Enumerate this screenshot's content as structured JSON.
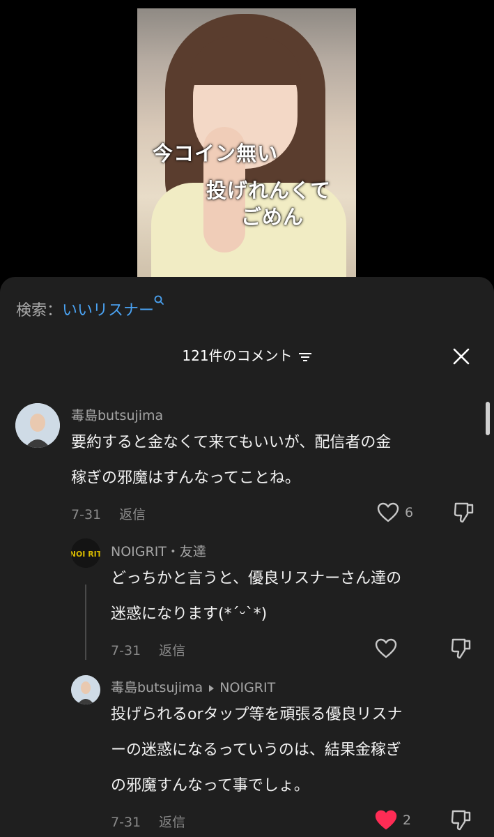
{
  "video": {
    "caption_line1": "今コイン無い",
    "caption_line2": "投げれんくて",
    "caption_line3": "ごめん"
  },
  "search": {
    "label": "検索：",
    "query": "いいリスナー"
  },
  "header": {
    "title": "121件のコメント"
  },
  "comments": [
    {
      "user": "毒島butsujima",
      "line1": "要約すると金なくて来てもいいが、配信者の金",
      "line2": "稼ぎの邪魔はすんなってことね。",
      "date": "7-31",
      "reply_label": "返信",
      "likes": "6",
      "liked": false
    },
    {
      "user": "NOIGRIT",
      "tag": "・友達",
      "line1": "どっちかと言うと、優良リスナーさん達の",
      "line2": "迷惑になります(*ˊᵕˋ*)",
      "date": "7-31",
      "reply_label": "返信",
      "likes": "",
      "liked": false
    },
    {
      "user": "毒島butsujima",
      "reply_to": "NOIGRIT",
      "line1": "投げられるorタップ等を頑張る優良リスナ",
      "line2": "ーの迷惑になるっていうのは、結果金稼ぎ",
      "line3": "の邪魔すんなって事でしょ。",
      "date": "7-31",
      "reply_label": "返信",
      "likes": "2",
      "liked": true
    }
  ],
  "colors": {
    "sheet": "#1f1f1f",
    "link": "#4aa2f2",
    "like": "#fe2c55"
  },
  "icons": [
    "search-icon",
    "filter-icon",
    "close-icon",
    "heart-icon",
    "dislike-icon",
    "caret-right-icon"
  ]
}
